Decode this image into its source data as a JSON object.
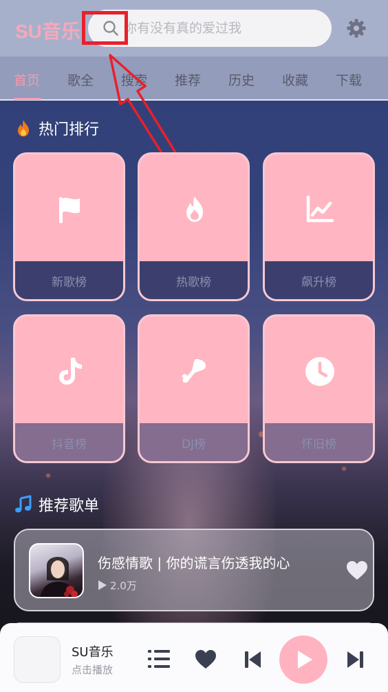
{
  "app": {
    "brand": "SU音乐"
  },
  "search": {
    "placeholder": "你有没有真的爱过我"
  },
  "tabs": [
    {
      "label": "首页",
      "active": true
    },
    {
      "label": "歌全"
    },
    {
      "label": "搜索"
    },
    {
      "label": "推荐"
    },
    {
      "label": "历史"
    },
    {
      "label": "收藏"
    },
    {
      "label": "下载"
    }
  ],
  "hot_section": {
    "title": "热门排行",
    "icon": "fire-icon"
  },
  "rank_cards": [
    {
      "label": "新歌榜",
      "icon": "flag-icon"
    },
    {
      "label": "热歌榜",
      "icon": "flame-icon"
    },
    {
      "label": "飙升榜",
      "icon": "trending-chart-icon"
    },
    {
      "label": "抖音榜",
      "icon": "tiktok-icon"
    },
    {
      "label": "DJ榜",
      "icon": "dj-icon"
    },
    {
      "label": "怀旧榜",
      "icon": "clock-icon"
    }
  ],
  "recommend_section": {
    "title": "推荐歌单",
    "icon": "music-note-icon"
  },
  "playlists": [
    {
      "title": "伤感情歌 | 你的谎言伤透我的心",
      "plays": "2.0万"
    }
  ],
  "player": {
    "title": "SU音乐",
    "subtitle": "点击播放"
  },
  "colors": {
    "accent": "#f39bb0",
    "card": "#ffb6c2",
    "annotation": "#e8202b"
  }
}
